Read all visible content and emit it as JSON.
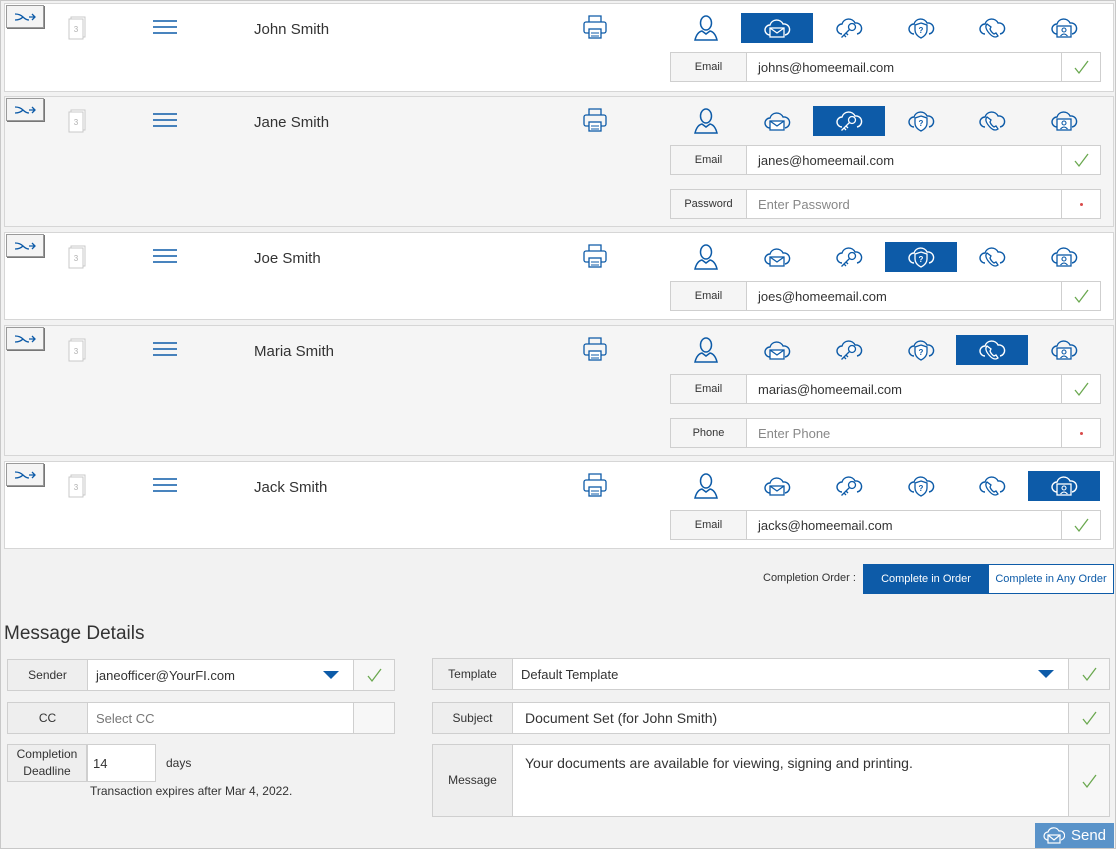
{
  "signers": [
    {
      "name": "John Smith",
      "active_method": 1,
      "fields": [
        {
          "label": "Email",
          "value": "johns@homeemail.com",
          "placeholder": "",
          "status": "ok"
        }
      ]
    },
    {
      "name": "Jane Smith",
      "active_method": 2,
      "fields": [
        {
          "label": "Email",
          "value": "janes@homeemail.com",
          "placeholder": "",
          "status": "ok"
        },
        {
          "label": "Password",
          "value": "",
          "placeholder": "Enter Password",
          "status": "required"
        }
      ]
    },
    {
      "name": "Joe Smith",
      "active_method": 3,
      "fields": [
        {
          "label": "Email",
          "value": "joes@homeemail.com",
          "placeholder": "",
          "status": "ok"
        }
      ]
    },
    {
      "name": "Maria Smith",
      "active_method": 4,
      "fields": [
        {
          "label": "Email",
          "value": "marias@homeemail.com",
          "placeholder": "",
          "status": "ok"
        },
        {
          "label": "Phone",
          "value": "",
          "placeholder": "Enter Phone",
          "status": "required"
        }
      ]
    },
    {
      "name": "Jack Smith",
      "active_method": 5,
      "fields": [
        {
          "label": "Email",
          "value": "jacks@homeemail.com",
          "placeholder": "",
          "status": "ok"
        }
      ]
    }
  ],
  "auth_methods": [
    "user-icon",
    "cloud-envelope-icon",
    "cloud-key-icon",
    "shield-question-icon",
    "cloud-phone-icon",
    "cloud-id-card-icon"
  ],
  "completion_order": {
    "label": "Completion Order :",
    "options": [
      "Complete in Order",
      "Complete in Any Order"
    ],
    "selected": 0
  },
  "message_details": {
    "title": "Message Details",
    "sender": {
      "label": "Sender",
      "value": "janeofficer@YourFI.com"
    },
    "cc": {
      "label": "CC",
      "placeholder": "Select CC"
    },
    "deadline": {
      "label_line1": "Completion",
      "label_line2": "Deadline",
      "value": "14",
      "unit": "days",
      "note": "Transaction expires after Mar 4, 2022."
    },
    "template": {
      "label": "Template",
      "value": "Default Template"
    },
    "subject": {
      "label": "Subject",
      "value": "Document Set (for John Smith)"
    },
    "message": {
      "label": "Message",
      "value": "Your documents are available for viewing, signing and printing."
    },
    "send_label": "Send"
  },
  "colors": {
    "accent": "#0d5ba8",
    "check": "#6aa84f",
    "send": "#5a93c9",
    "required": "#d94a4a"
  }
}
